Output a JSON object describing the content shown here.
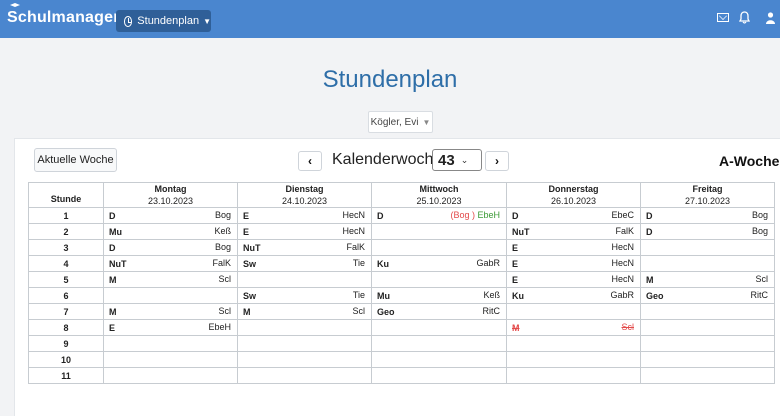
{
  "header": {
    "brand": "Schulmanager",
    "nav_label": "Stundenplan"
  },
  "page": {
    "title": "Stundenplan",
    "teacher": "Kögler, Evi"
  },
  "toolbar": {
    "current_week": "Aktuelle Woche",
    "prev": "‹",
    "next": "›",
    "kw_label": "Kalenderwoche",
    "kw_value": "43",
    "week_type": "A-Woche"
  },
  "table": {
    "stunde_label": "Stunde",
    "days": [
      {
        "name": "Montag",
        "date": "23.10.2023"
      },
      {
        "name": "Dienstag",
        "date": "24.10.2023"
      },
      {
        "name": "Mittwoch",
        "date": "25.10.2023"
      },
      {
        "name": "Donnerstag",
        "date": "26.10.2023"
      },
      {
        "name": "Freitag",
        "date": "27.10.2023"
      }
    ],
    "rows": [
      {
        "n": "1",
        "cells": [
          {
            "s": "D",
            "t": "Bog"
          },
          {
            "s": "E",
            "t": "HecN"
          },
          {
            "s": "D",
            "t": "(Bog )",
            "t2": "EbeH",
            "special": "sub"
          },
          {
            "s": "D",
            "t": "EbeC"
          },
          {
            "s": "D",
            "t": "Bog"
          }
        ]
      },
      {
        "n": "2",
        "cells": [
          {
            "s": "Mu",
            "t": "Keß"
          },
          {
            "s": "E",
            "t": "HecN"
          },
          {},
          {
            "s": "NuT",
            "t": "FalK"
          },
          {
            "s": "D",
            "t": "Bog"
          }
        ]
      },
      {
        "n": "3",
        "cells": [
          {
            "s": "D",
            "t": "Bog"
          },
          {
            "s": "NuT",
            "t": "FalK"
          },
          {},
          {
            "s": "E",
            "t": "HecN"
          },
          {}
        ]
      },
      {
        "n": "4",
        "cells": [
          {
            "s": "NuT",
            "t": "FalK"
          },
          {
            "s": "Sw",
            "t": "Tie"
          },
          {
            "s": "Ku",
            "t": "GabR"
          },
          {
            "s": "E",
            "t": "HecN"
          },
          {}
        ]
      },
      {
        "n": "5",
        "cells": [
          {
            "s": "M",
            "t": "Scl"
          },
          {},
          {},
          {
            "s": "E",
            "t": "HecN"
          },
          {
            "s": "M",
            "t": "Scl"
          }
        ]
      },
      {
        "n": "6",
        "cells": [
          {},
          {
            "s": "Sw",
            "t": "Tie"
          },
          {
            "s": "Mu",
            "t": "Keß"
          },
          {
            "s": "Ku",
            "t": "GabR"
          },
          {
            "s": "Geo",
            "t": "RitC"
          }
        ]
      },
      {
        "n": "7",
        "cells": [
          {
            "s": "M",
            "t": "Scl"
          },
          {
            "s": "M",
            "t": "Scl"
          },
          {
            "s": "Geo",
            "t": "RitC"
          },
          {},
          {}
        ]
      },
      {
        "n": "8",
        "cells": [
          {
            "s": "E",
            "t": "EbeH"
          },
          {},
          {},
          {
            "s": "M",
            "t": "Scl",
            "special": "cancelled"
          },
          {}
        ]
      },
      {
        "n": "9",
        "cells": [
          {},
          {},
          {},
          {},
          {}
        ]
      },
      {
        "n": "10",
        "cells": [
          {},
          {},
          {},
          {},
          {}
        ]
      },
      {
        "n": "11",
        "cells": [
          {},
          {},
          {},
          {},
          {}
        ]
      }
    ]
  },
  "colors": {
    "brand_bar": "#4a86cf",
    "title": "#2e6ea8",
    "cancelled": "#e34a4a",
    "substitute": "#3c9a36"
  }
}
